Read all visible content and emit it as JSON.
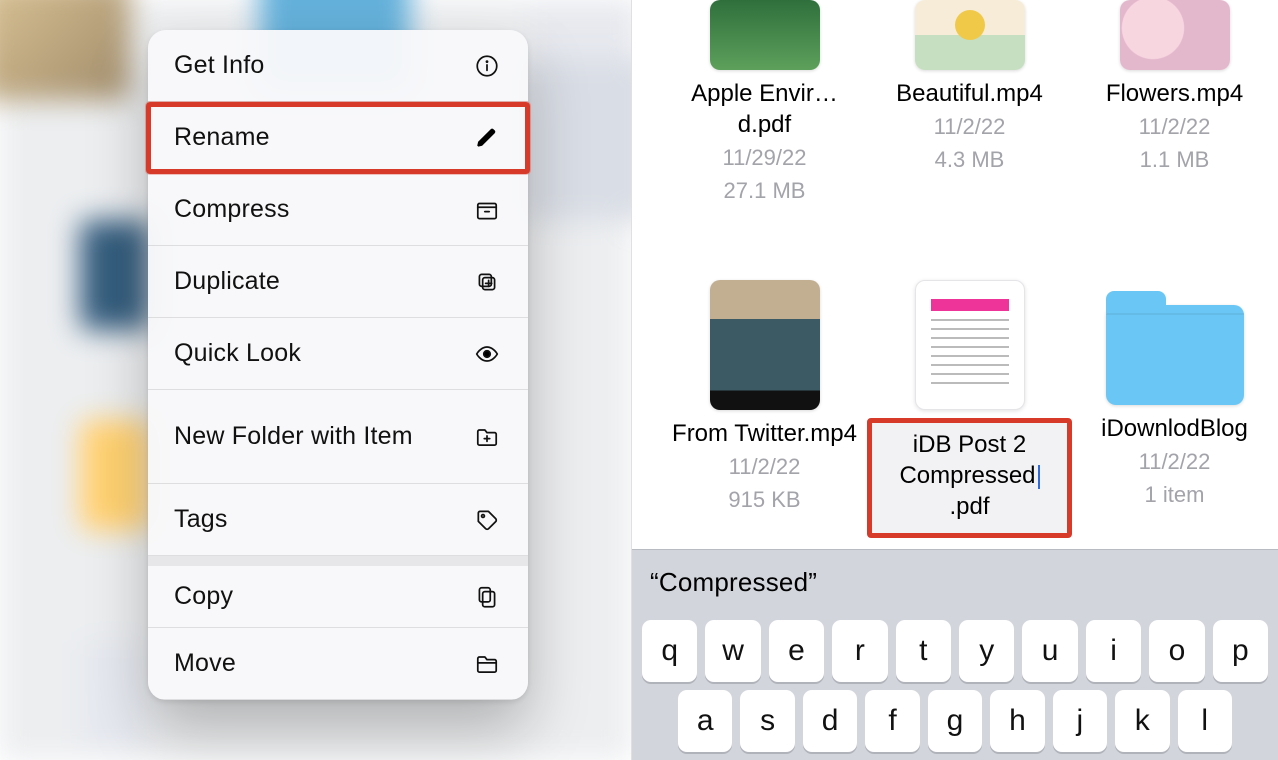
{
  "context_menu": {
    "items": [
      {
        "label": "Get Info",
        "icon": "info-icon"
      },
      {
        "label": "Rename",
        "icon": "pencil-icon",
        "highlighted": true
      },
      {
        "label": "Compress",
        "icon": "archive-icon"
      },
      {
        "label": "Duplicate",
        "icon": "duplicate-icon"
      },
      {
        "label": "Quick Look",
        "icon": "eye-icon"
      },
      {
        "label": "New Folder with Item",
        "icon": "new-folder-icon",
        "tall": true
      },
      {
        "label": "Tags",
        "icon": "tag-icon"
      },
      {
        "label": "Copy",
        "icon": "copy-icon",
        "gap": true
      },
      {
        "label": "Move",
        "icon": "move-folder-icon"
      }
    ]
  },
  "files": {
    "row1": [
      {
        "name": "Apple Envir…d.pdf",
        "date": "11/29/22",
        "meta": "27.1 MB",
        "thumb": "apple"
      },
      {
        "name": "Beautiful.mp4",
        "date": "11/2/22",
        "meta": "4.3 MB",
        "thumb": "beautiful"
      },
      {
        "name": "Flowers.mp4",
        "date": "11/2/22",
        "meta": "1.1 MB",
        "thumb": "flowers"
      }
    ],
    "row2": [
      {
        "name": "From Twitter.mp4",
        "date": "11/2/22",
        "meta": "915 KB",
        "thumb": "twitter"
      },
      {
        "name": "iDB Post 2 Compressed.pdf",
        "rename": true,
        "thumb": "doc"
      },
      {
        "name": "iDownlodBlog",
        "date": "11/2/22",
        "meta": "1 item",
        "thumb": "folder"
      }
    ]
  },
  "keyboard": {
    "suggestion": "“Compressed”",
    "row1": [
      "q",
      "w",
      "e",
      "r",
      "t",
      "y",
      "u",
      "i",
      "o",
      "p"
    ],
    "row2": [
      "a",
      "s",
      "d",
      "f",
      "g",
      "h",
      "j",
      "k",
      "l"
    ]
  }
}
